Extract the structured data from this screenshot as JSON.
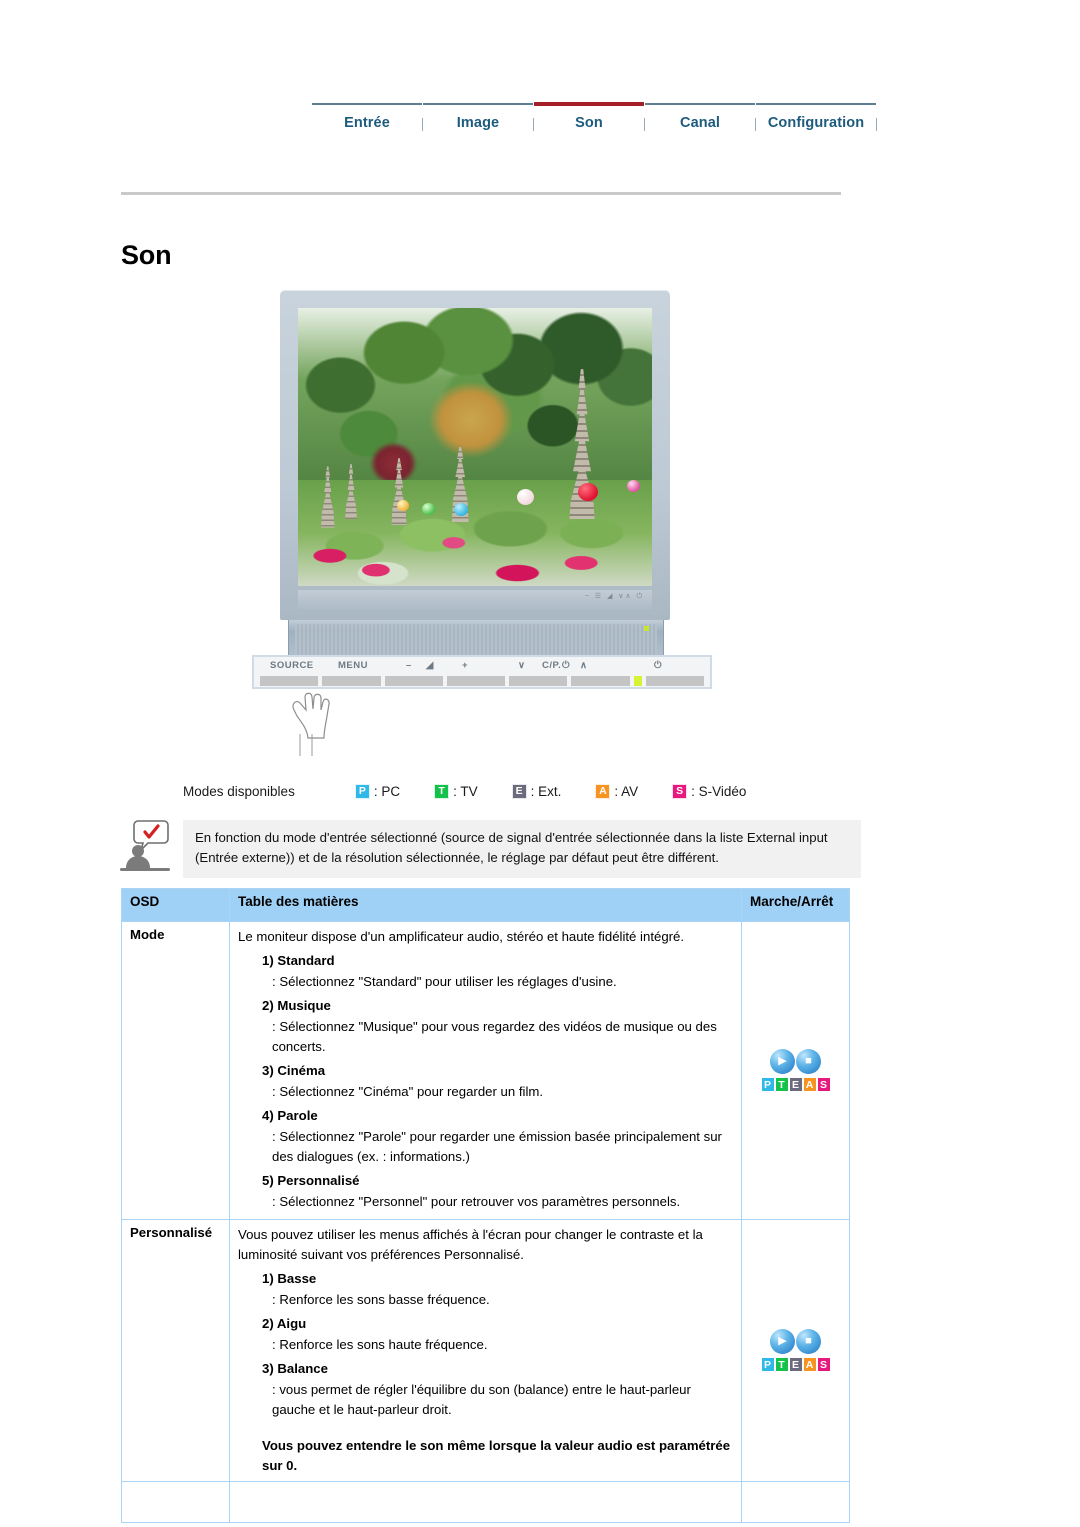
{
  "nav": {
    "items": [
      {
        "label": "Entrée",
        "active": false
      },
      {
        "label": "Image",
        "active": false
      },
      {
        "label": "Son",
        "active": true
      },
      {
        "label": "Canal",
        "active": false
      },
      {
        "label": "Configuration",
        "active": false
      }
    ],
    "active_color": "#a41f28",
    "text_color": "#1d5b7d"
  },
  "page": {
    "title": "Son"
  },
  "monitor": {
    "controls": {
      "source_label": "SOURCE",
      "menu_label": "MENU",
      "minus_label": "–",
      "volume_label": "◢",
      "plus_label": "+",
      "down_label": "∨",
      "channel_label": "C/P.",
      "channel_power_glyph": "⏻",
      "up_label": "∧",
      "power_label": "⏻"
    }
  },
  "modes": {
    "label": "Modes disponibles",
    "items": [
      {
        "letter": "P",
        "text": ": PC",
        "color": "#2fb8e8"
      },
      {
        "letter": "T",
        "text": ": TV",
        "color": "#12c24a"
      },
      {
        "letter": "E",
        "text": ": Ext.",
        "color": "#6b6b7d"
      },
      {
        "letter": "A",
        "text": ": AV",
        "color": "#f79321"
      },
      {
        "letter": "S",
        "text": ": S-Vidéo",
        "color": "#e6197f"
      }
    ]
  },
  "note": {
    "icon": "person-check-icon",
    "text": "En fonction du mode d'entrée sélectionné (source de signal d'entrée sélectionnée dans la liste External input (Entrée externe)) et de la résolution sélectionnée, le réglage par défaut peut être différent."
  },
  "table": {
    "headers": {
      "osd": "OSD",
      "toc": "Table des matières",
      "onoff": "Marche/Arrêt"
    },
    "header_bg": "#9fd0f5",
    "border_color": "#a9d4f5",
    "rows": [
      {
        "osd": "Mode",
        "lead": "Le moniteur dispose d'un amplificateur audio, stéréo et haute fidélité intégré.",
        "items": [
          {
            "head": "1) Standard",
            "body": ": Sélectionnez \"Standard\" pour utiliser les réglages d'usine."
          },
          {
            "head": "2) Musique",
            "body": ": Sélectionnez \"Musique\" pour vous regardez des vidéos de musique ou des concerts."
          },
          {
            "head": "3) Cinéma",
            "body": ": Sélectionnez \"Cinéma\" pour regarder un film."
          },
          {
            "head": "4) Parole",
            "body": ": Sélectionnez \"Parole\" pour regarder une émission basée principalement sur des dialogues (ex. : informations.)"
          },
          {
            "head": "5) Personnalisé",
            "body": ": Sélectionnez \"Personnel\" pour retrouver vos paramètres personnels."
          }
        ],
        "bold_note": "",
        "badge": "PTEAS"
      },
      {
        "osd": "Personnalisé",
        "lead": "Vous pouvez utiliser les menus affichés à l'écran pour changer le contraste et la luminosité suivant vos préférences Personnalisé.",
        "items": [
          {
            "head": "1) Basse",
            "body": ": Renforce les sons basse fréquence."
          },
          {
            "head": "2) Aigu",
            "body": ": Renforce les sons haute fréquence."
          },
          {
            "head": "3) Balance",
            "body": ": vous permet de régler l'équilibre du son (balance) entre le haut-parleur gauche et le haut-parleur droit."
          }
        ],
        "bold_note": "Vous pouvez entendre le son même lorsque la valeur audio est paramétrée sur 0.",
        "badge": "PTEAS"
      }
    ],
    "badge": {
      "discs": [
        "play-disc",
        "stop-disc"
      ],
      "letters": [
        {
          "letter": "P",
          "color": "#2fb8e8"
        },
        {
          "letter": "T",
          "color": "#12c24a"
        },
        {
          "letter": "E",
          "color": "#6b6b7d"
        },
        {
          "letter": "A",
          "color": "#f79321"
        },
        {
          "letter": "S",
          "color": "#e6197f"
        }
      ]
    }
  }
}
